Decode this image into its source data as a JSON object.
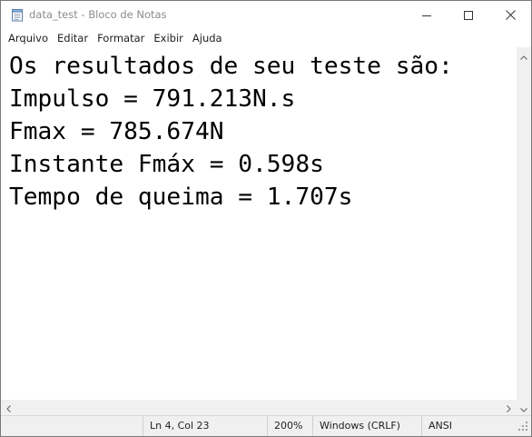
{
  "window": {
    "title": "data_test - Bloco de Notas"
  },
  "menu": [
    {
      "label": "Arquivo"
    },
    {
      "label": "Editar"
    },
    {
      "label": "Formatar"
    },
    {
      "label": "Exibir"
    },
    {
      "label": "Ajuda"
    }
  ],
  "document": {
    "lines": [
      "Os resultados de seu teste são:",
      "Impulso = 791.213N.s",
      "Fmax = 785.674N",
      "Instante Fmáx = 0.598s",
      "Tempo de queima = 1.707s"
    ]
  },
  "status": {
    "position": "Ln 4, Col 23",
    "zoom": "200%",
    "line_ending": "Windows (CRLF)",
    "encoding": "ANSI"
  },
  "icons": {
    "app": "notepad-icon",
    "minimize": "minimize-icon",
    "maximize": "maximize-icon",
    "close": "close-icon"
  },
  "colors": {
    "title_text": "#8c8c8c",
    "statusbar_bg": "#f0f0f0",
    "text": "#000000"
  }
}
